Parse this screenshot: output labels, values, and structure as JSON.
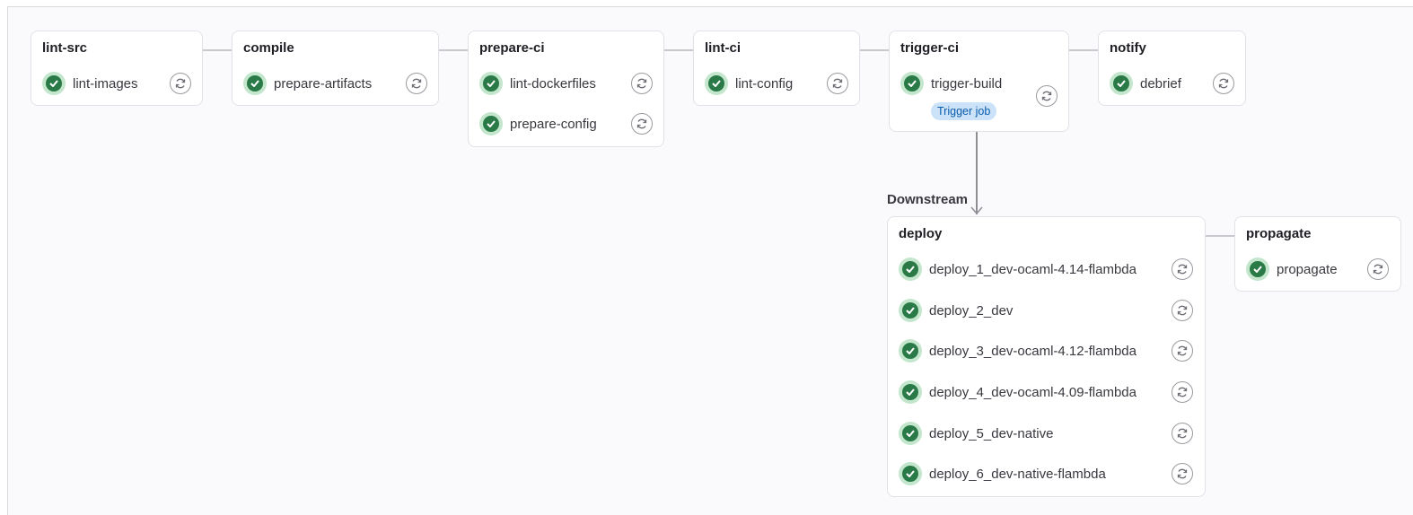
{
  "stages": [
    {
      "id": "lint-src",
      "title": "lint-src",
      "jobs": [
        "lint-images"
      ]
    },
    {
      "id": "compile",
      "title": "compile",
      "jobs": [
        "prepare-artifacts"
      ]
    },
    {
      "id": "prepare-ci",
      "title": "prepare-ci",
      "jobs": [
        "lint-dockerfiles",
        "prepare-config"
      ]
    },
    {
      "id": "lint-ci",
      "title": "lint-ci",
      "jobs": [
        "lint-config"
      ]
    },
    {
      "id": "trigger-ci",
      "title": "trigger-ci",
      "jobs": [
        "trigger-build"
      ],
      "badge": "Trigger job"
    },
    {
      "id": "notify",
      "title": "notify",
      "jobs": [
        "debrief"
      ]
    }
  ],
  "downstream": {
    "label": "Downstream",
    "stages": [
      {
        "id": "deploy",
        "title": "deploy",
        "jobs": [
          "deploy_1_dev-ocaml-4.14-flambda",
          "deploy_2_dev",
          "deploy_3_dev-ocaml-4.12-flambda",
          "deploy_4_dev-ocaml-4.09-flambda",
          "deploy_5_dev-native",
          "deploy_6_dev-native-flambda"
        ]
      },
      {
        "id": "propagate",
        "title": "propagate",
        "jobs": [
          "propagate"
        ]
      }
    ]
  },
  "colors": {
    "success": "#2a7a47",
    "success_ring": "#c3e6cd",
    "badge_bg": "#cbe2f9",
    "badge_text": "#0b5cad"
  },
  "icons": {
    "status": "check-circle-icon",
    "retry": "retry-icon"
  }
}
